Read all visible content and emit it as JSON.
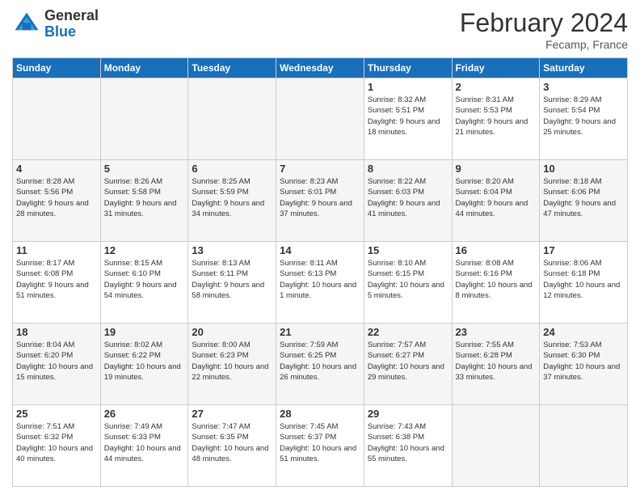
{
  "header": {
    "logo_general": "General",
    "logo_blue": "Blue",
    "title": "February 2024",
    "location": "Fecamp, France"
  },
  "days_of_week": [
    "Sunday",
    "Monday",
    "Tuesday",
    "Wednesday",
    "Thursday",
    "Friday",
    "Saturday"
  ],
  "weeks": [
    {
      "days": [
        {
          "num": "",
          "info": ""
        },
        {
          "num": "",
          "info": ""
        },
        {
          "num": "",
          "info": ""
        },
        {
          "num": "",
          "info": ""
        },
        {
          "num": "1",
          "info": "Sunrise: 8:32 AM\nSunset: 5:51 PM\nDaylight: 9 hours and 18 minutes."
        },
        {
          "num": "2",
          "info": "Sunrise: 8:31 AM\nSunset: 5:53 PM\nDaylight: 9 hours and 21 minutes."
        },
        {
          "num": "3",
          "info": "Sunrise: 8:29 AM\nSunset: 5:54 PM\nDaylight: 9 hours and 25 minutes."
        }
      ]
    },
    {
      "days": [
        {
          "num": "4",
          "info": "Sunrise: 8:28 AM\nSunset: 5:56 PM\nDaylight: 9 hours and 28 minutes."
        },
        {
          "num": "5",
          "info": "Sunrise: 8:26 AM\nSunset: 5:58 PM\nDaylight: 9 hours and 31 minutes."
        },
        {
          "num": "6",
          "info": "Sunrise: 8:25 AM\nSunset: 5:59 PM\nDaylight: 9 hours and 34 minutes."
        },
        {
          "num": "7",
          "info": "Sunrise: 8:23 AM\nSunset: 6:01 PM\nDaylight: 9 hours and 37 minutes."
        },
        {
          "num": "8",
          "info": "Sunrise: 8:22 AM\nSunset: 6:03 PM\nDaylight: 9 hours and 41 minutes."
        },
        {
          "num": "9",
          "info": "Sunrise: 8:20 AM\nSunset: 6:04 PM\nDaylight: 9 hours and 44 minutes."
        },
        {
          "num": "10",
          "info": "Sunrise: 8:18 AM\nSunset: 6:06 PM\nDaylight: 9 hours and 47 minutes."
        }
      ]
    },
    {
      "days": [
        {
          "num": "11",
          "info": "Sunrise: 8:17 AM\nSunset: 6:08 PM\nDaylight: 9 hours and 51 minutes."
        },
        {
          "num": "12",
          "info": "Sunrise: 8:15 AM\nSunset: 6:10 PM\nDaylight: 9 hours and 54 minutes."
        },
        {
          "num": "13",
          "info": "Sunrise: 8:13 AM\nSunset: 6:11 PM\nDaylight: 9 hours and 58 minutes."
        },
        {
          "num": "14",
          "info": "Sunrise: 8:11 AM\nSunset: 6:13 PM\nDaylight: 10 hours and 1 minute."
        },
        {
          "num": "15",
          "info": "Sunrise: 8:10 AM\nSunset: 6:15 PM\nDaylight: 10 hours and 5 minutes."
        },
        {
          "num": "16",
          "info": "Sunrise: 8:08 AM\nSunset: 6:16 PM\nDaylight: 10 hours and 8 minutes."
        },
        {
          "num": "17",
          "info": "Sunrise: 8:06 AM\nSunset: 6:18 PM\nDaylight: 10 hours and 12 minutes."
        }
      ]
    },
    {
      "days": [
        {
          "num": "18",
          "info": "Sunrise: 8:04 AM\nSunset: 6:20 PM\nDaylight: 10 hours and 15 minutes."
        },
        {
          "num": "19",
          "info": "Sunrise: 8:02 AM\nSunset: 6:22 PM\nDaylight: 10 hours and 19 minutes."
        },
        {
          "num": "20",
          "info": "Sunrise: 8:00 AM\nSunset: 6:23 PM\nDaylight: 10 hours and 22 minutes."
        },
        {
          "num": "21",
          "info": "Sunrise: 7:59 AM\nSunset: 6:25 PM\nDaylight: 10 hours and 26 minutes."
        },
        {
          "num": "22",
          "info": "Sunrise: 7:57 AM\nSunset: 6:27 PM\nDaylight: 10 hours and 29 minutes."
        },
        {
          "num": "23",
          "info": "Sunrise: 7:55 AM\nSunset: 6:28 PM\nDaylight: 10 hours and 33 minutes."
        },
        {
          "num": "24",
          "info": "Sunrise: 7:53 AM\nSunset: 6:30 PM\nDaylight: 10 hours and 37 minutes."
        }
      ]
    },
    {
      "days": [
        {
          "num": "25",
          "info": "Sunrise: 7:51 AM\nSunset: 6:32 PM\nDaylight: 10 hours and 40 minutes."
        },
        {
          "num": "26",
          "info": "Sunrise: 7:49 AM\nSunset: 6:33 PM\nDaylight: 10 hours and 44 minutes."
        },
        {
          "num": "27",
          "info": "Sunrise: 7:47 AM\nSunset: 6:35 PM\nDaylight: 10 hours and 48 minutes."
        },
        {
          "num": "28",
          "info": "Sunrise: 7:45 AM\nSunset: 6:37 PM\nDaylight: 10 hours and 51 minutes."
        },
        {
          "num": "29",
          "info": "Sunrise: 7:43 AM\nSunset: 6:38 PM\nDaylight: 10 hours and 55 minutes."
        },
        {
          "num": "",
          "info": ""
        },
        {
          "num": "",
          "info": ""
        }
      ]
    }
  ]
}
